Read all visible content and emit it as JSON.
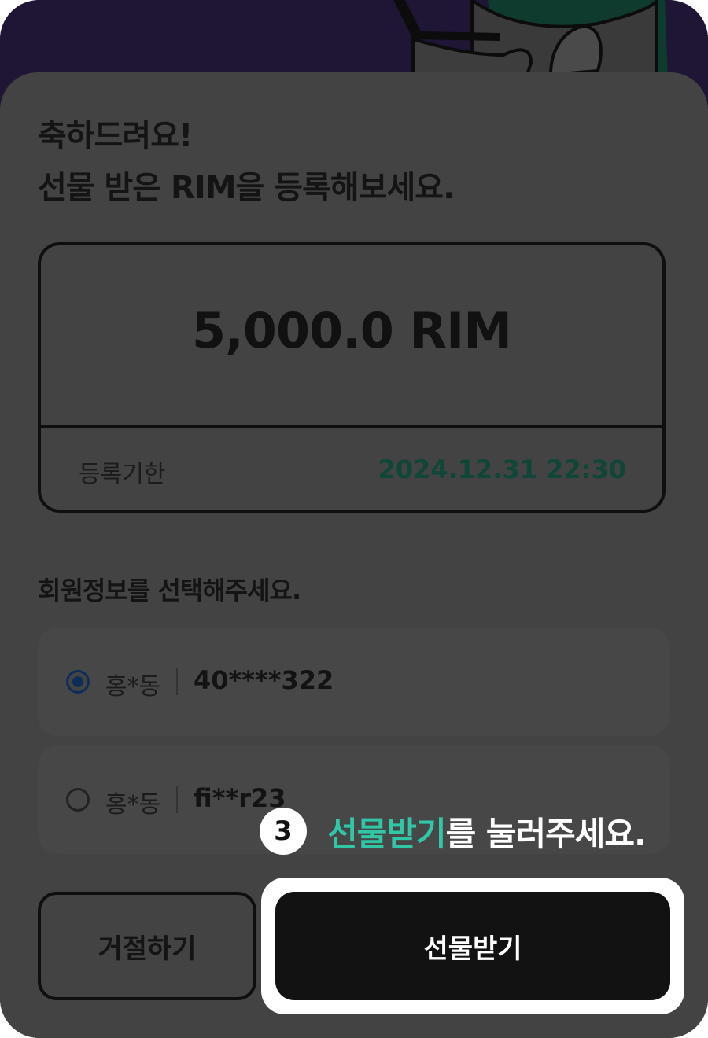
{
  "headline": {
    "line1": "축하드려요!",
    "line2": "선물 받은 RIM을 등록해보세요."
  },
  "gift_card": {
    "amount": "5,000.0 RIM",
    "deadline_label": "등록기한",
    "deadline_value": "2024.12.31 22:30"
  },
  "members": {
    "heading": "회원정보를 선택해주세요.",
    "options": [
      {
        "name": "홍*동",
        "id": "40****322",
        "selected": true
      },
      {
        "name": "홍*동",
        "id": "fi**r23",
        "selected": false
      }
    ]
  },
  "tooltip": {
    "step": "3",
    "highlight": "선물받기",
    "rest": "를 눌러주세요."
  },
  "buttons": {
    "reject": "거절하기",
    "receive": "선물받기"
  },
  "colors": {
    "backdrop": "#1e1634",
    "sheet_overlay": "#434343",
    "deadline": "#0f4638",
    "accent_highlight": "#2fc7a5",
    "primary_button": "#121212"
  }
}
